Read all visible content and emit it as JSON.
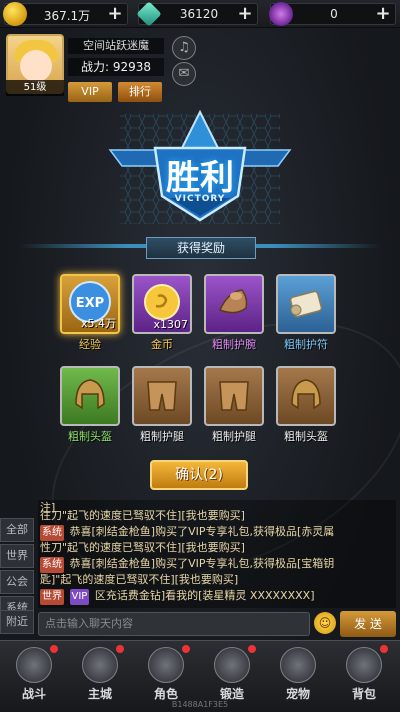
{
  "resources": [
    {
      "name": "gold-coin",
      "value": "367.1万"
    },
    {
      "name": "gem",
      "value": "36120"
    },
    {
      "name": "crystal",
      "value": "0"
    }
  ],
  "player": {
    "name": "空间站跃迷魔",
    "power": "战力: 92938",
    "level": "51级",
    "vip_label": "VIP",
    "rank_label": "排行"
  },
  "victory": {
    "title": "胜利",
    "subtitle": "VICTORY"
  },
  "rewards": {
    "header": "获得奖励",
    "items": [
      {
        "label": "经验",
        "qty": "x5.4万",
        "rarity": "gold"
      },
      {
        "label": "金币",
        "qty": "x1307",
        "rarity": "purple"
      },
      {
        "label": "粗制护腕",
        "qty": "",
        "rarity": "purple"
      },
      {
        "label": "粗制护符",
        "qty": "",
        "rarity": "blue"
      },
      {
        "label": "粗制头盔",
        "qty": "",
        "rarity": "green"
      },
      {
        "label": "粗制护腿",
        "qty": "",
        "rarity": "brown"
      },
      {
        "label": "粗制护腿",
        "qty": "",
        "rarity": "brown"
      },
      {
        "label": "粗制头盔",
        "qty": "",
        "rarity": "brown"
      }
    ],
    "confirm": "确认(2)"
  },
  "chat": {
    "tabs": [
      "全部",
      "世界",
      "公会",
      "系统",
      "附近"
    ],
    "lines": [
      {
        "tag": "",
        "text": "注]"
      },
      {
        "tag": "",
        "text": "往刀\"起飞的速度已驽驭不住][我也要购买]"
      },
      {
        "tag": "系统",
        "text": "恭喜[刺结金枪鱼]购买了VIP专享礼包,获得极品[赤灵属"
      },
      {
        "tag": "",
        "text": "性刀\"起飞的速度已驽驭不住][我也要购买]"
      },
      {
        "tag": "系统",
        "text": "恭喜[刺结金枪鱼]购买了VIP专享礼包,获得极品[宝箱钥"
      },
      {
        "tag": "",
        "text": "匙]\"起飞的速度已驽驭不住][我也要购买]"
      },
      {
        "tag": "世界",
        "vip": "VIP",
        "text": "区充话费金钻]看我的[装星精灵 XXXXXXXX]"
      }
    ],
    "input_placeholder": "点击输入聊天内容",
    "send": "发 送"
  },
  "nav": [
    {
      "label": "战斗",
      "badge": true
    },
    {
      "label": "主城",
      "badge": true
    },
    {
      "label": "角色",
      "badge": true
    },
    {
      "label": "锻造",
      "badge": true
    },
    {
      "label": "宠物",
      "badge": false
    },
    {
      "label": "背包",
      "badge": true
    }
  ],
  "footer_id": "B1488A1F3E5"
}
